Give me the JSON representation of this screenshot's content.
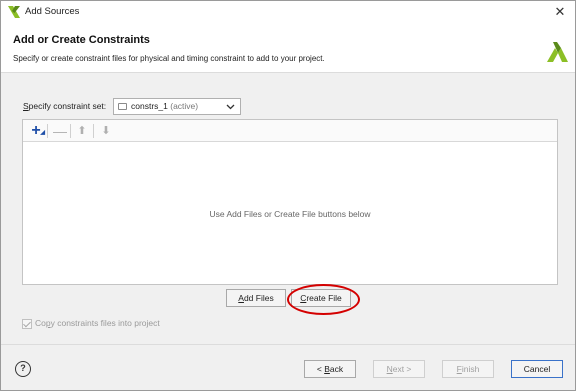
{
  "window": {
    "title": "Add Sources"
  },
  "header": {
    "heading": "Add or Create Constraints",
    "description": "Specify or create constraint files for physical and timing constraint to add to your project."
  },
  "constraint_set": {
    "label_prefix": "S",
    "label_rest": "pecify constraint set:",
    "selected_name": "constrs_1",
    "selected_status": "(active)"
  },
  "file_list": {
    "empty_message": "Use Add Files or Create File buttons below"
  },
  "buttons": {
    "add_files_u": "A",
    "add_files_rest": "dd Files",
    "create_file_u": "C",
    "create_file_rest": "reate File"
  },
  "copy_option": {
    "label_prefix": "Co",
    "label_u": "p",
    "label_rest": "y constraints files into project",
    "checked": true,
    "enabled": false
  },
  "footer": {
    "help": "?",
    "back_prefix": "< ",
    "back_u": "B",
    "back_rest": "ack",
    "next_u": "N",
    "next_rest": "ext >",
    "finish_u": "F",
    "finish_rest": "inish",
    "cancel": "Cancel"
  },
  "icons": {
    "app": "vivado-logo-icon",
    "logo": "vivado-logo-icon"
  },
  "colors": {
    "accent": "#8cbf26",
    "highlight": "#d40000",
    "add_blue": "#1f4fa8"
  }
}
